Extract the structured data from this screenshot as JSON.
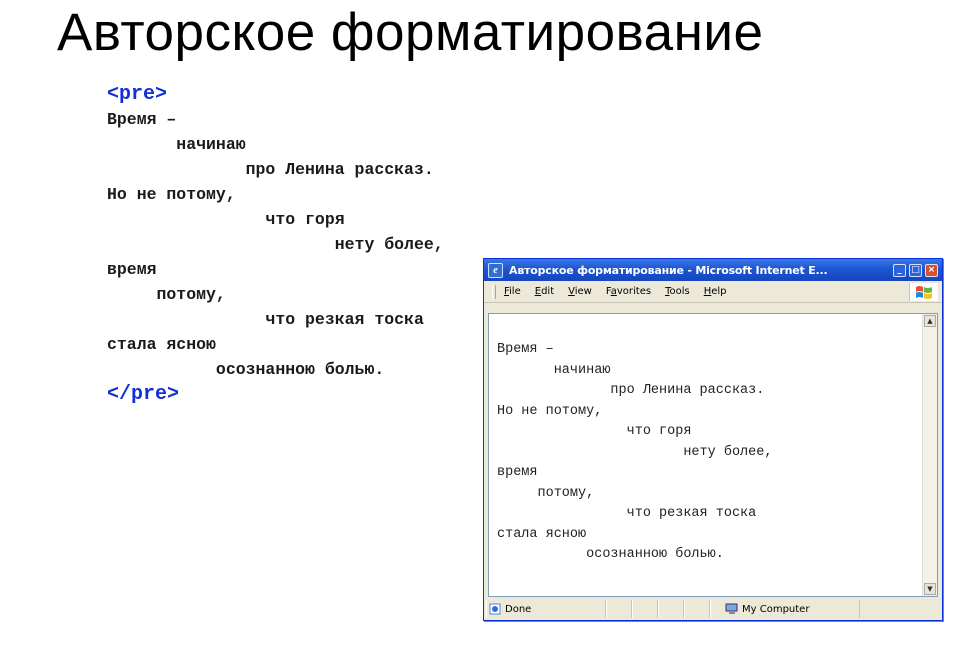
{
  "slide": {
    "title": "Авторское форматирование"
  },
  "code": {
    "open_tag": "<pre>",
    "lines": [
      "Время –",
      "       начинаю",
      "              про Ленина рассказ.",
      "Но не потому,",
      "                что горя",
      "                       нету более,",
      "время",
      "     потому,",
      "                что резкая тоска",
      "стала ясною",
      "           осознанною болью."
    ],
    "close_tag": "</pre>"
  },
  "browser": {
    "title": "Авторское форматирование - Microsoft Internet E...",
    "menu": [
      "File",
      "Edit",
      "View",
      "Favorites",
      "Tools",
      "Help"
    ],
    "menu_access_keys": [
      "F",
      "E",
      "V",
      "a",
      "T",
      "H"
    ],
    "page_lines": [
      "Время –",
      "       начинаю",
      "              про Ленина рассказ.",
      "Но не потому,",
      "                что горя",
      "                       нету более,",
      "время",
      "     потому,",
      "                что резкая тоска",
      "стала ясною",
      "           осознанною болью."
    ],
    "status": {
      "text": "Done",
      "zone": "My Computer"
    }
  }
}
